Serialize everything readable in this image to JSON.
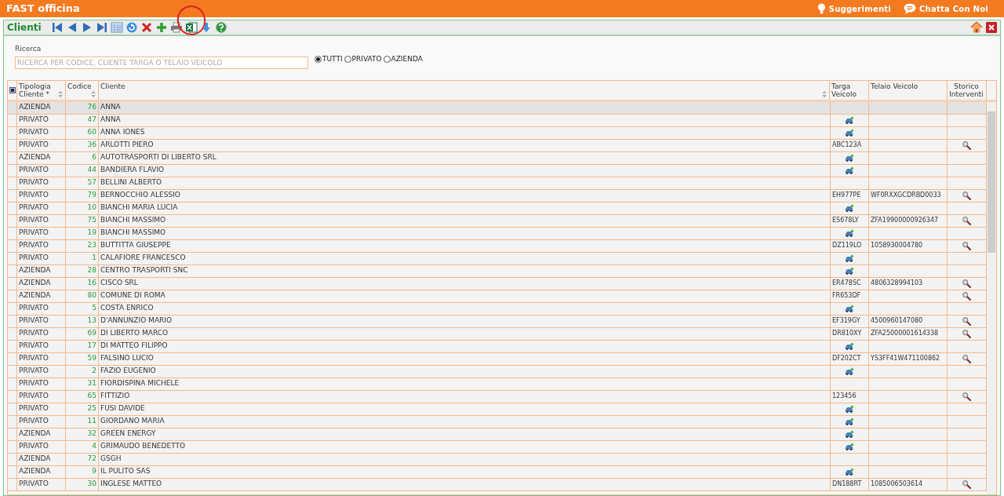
{
  "app": {
    "title": "FAST officina",
    "links": [
      {
        "kind": "bulb",
        "label": "Suggerimenti"
      },
      {
        "kind": "chat",
        "label": "Chatta Con Noi"
      }
    ]
  },
  "toolbar": {
    "title": "Clienti",
    "annotation_circle": true
  },
  "search": {
    "label": "Ricerca",
    "placeholder": "RICERCA PER CODICE, CLIENTE TARGA O TELAIO VEICOLO",
    "filters": [
      {
        "label": "TUTTI",
        "selected": true
      },
      {
        "label": "PRIVATO",
        "selected": false
      },
      {
        "label": "AZIENDA",
        "selected": false
      }
    ]
  },
  "table": {
    "select_all_checked": true,
    "columns": [
      {
        "label": "Tipologia Cliente *",
        "sortable": true
      },
      {
        "label": "Codice",
        "sortable": true
      },
      {
        "label": "Cliente",
        "sortable": true
      },
      {
        "label": "Targa Veicolo",
        "sortable": false
      },
      {
        "label": "Telaio Veicolo",
        "sortable": false
      },
      {
        "label": "Storico Interventi",
        "sortable": false
      }
    ],
    "rows": [
      {
        "tipologia": "AZIENDA",
        "codice": "76",
        "cliente": "ANNA",
        "add_vehicle": false,
        "history": false,
        "selected": true
      },
      {
        "tipologia": "PRIVATO",
        "codice": "47",
        "cliente": "ANNA",
        "add_vehicle": true,
        "history": false,
        "selected": false
      },
      {
        "tipologia": "PRIVATO",
        "codice": "60",
        "cliente": "ANNA IONES",
        "add_vehicle": true,
        "history": false,
        "selected": false
      },
      {
        "tipologia": "PRIVATO",
        "codice": "36",
        "cliente": "ARLOTTI PIERO",
        "targa": "ABC123A",
        "add_vehicle": false,
        "history": true,
        "selected": false
      },
      {
        "tipologia": "AZIENDA",
        "codice": "6",
        "cliente": "AUTOTRASPORTI DI LIBERTO SRL",
        "add_vehicle": true,
        "history": false,
        "selected": false
      },
      {
        "tipologia": "PRIVATO",
        "codice": "44",
        "cliente": "BANDIERA FLAVIO",
        "add_vehicle": true,
        "history": false,
        "selected": false
      },
      {
        "tipologia": "PRIVATO",
        "codice": "57",
        "cliente": "BELLINI ALBERTO",
        "add_vehicle": false,
        "history": false,
        "selected": false
      },
      {
        "tipologia": "PRIVATO",
        "codice": "79",
        "cliente": "BERNOCCHIO ALESSIO",
        "targa": "EH977PE",
        "telaio": "WF0RXXGCDRBD0033",
        "add_vehicle": false,
        "history": true,
        "selected": false
      },
      {
        "tipologia": "PRIVATO",
        "codice": "10",
        "cliente": "BIANCHI MARIA LUCIA",
        "add_vehicle": true,
        "history": false,
        "selected": false
      },
      {
        "tipologia": "PRIVATO",
        "codice": "75",
        "cliente": "BIANCHI MASSIMO",
        "targa": "ES678LY",
        "telaio": "ZFA19900000926347",
        "add_vehicle": false,
        "history": true,
        "selected": false
      },
      {
        "tipologia": "PRIVATO",
        "codice": "19",
        "cliente": "BIANCHI MASSIMO",
        "add_vehicle": true,
        "history": false,
        "selected": false
      },
      {
        "tipologia": "PRIVATO",
        "codice": "23",
        "cliente": "BUTTITTA GIUSEPPE",
        "targa": "DZ119LO",
        "telaio": "1058930004780",
        "add_vehicle": false,
        "history": true,
        "selected": false
      },
      {
        "tipologia": "PRIVATO",
        "codice": "1",
        "cliente": "CALAFIORE FRANCESCO",
        "add_vehicle": true,
        "history": false,
        "selected": false
      },
      {
        "tipologia": "AZIENDA",
        "codice": "28",
        "cliente": "CENTRO TRASPORTI SNC",
        "add_vehicle": true,
        "history": false,
        "selected": false
      },
      {
        "tipologia": "AZIENDA",
        "codice": "16",
        "cliente": "CISCO SRL",
        "targa": "ER478SC",
        "telaio": "4806328994103",
        "add_vehicle": false,
        "history": true,
        "selected": false
      },
      {
        "tipologia": "AZIENDA",
        "codice": "80",
        "cliente": "COMUNE DI ROMA",
        "targa": "FR653DF",
        "add_vehicle": false,
        "history": true,
        "selected": false
      },
      {
        "tipologia": "PRIVATO",
        "codice": "5",
        "cliente": "COSTA ENRICO",
        "add_vehicle": true,
        "history": false,
        "selected": false
      },
      {
        "tipologia": "PRIVATO",
        "codice": "13",
        "cliente": "D'ANNUNZIO MARIO",
        "targa": "EF319GY",
        "telaio": "4500960147080",
        "add_vehicle": false,
        "history": true,
        "selected": false
      },
      {
        "tipologia": "PRIVATO",
        "codice": "69",
        "cliente": "DI LIBERTO MARCO",
        "targa": "DR810XY",
        "telaio": "ZFA25000001614338",
        "add_vehicle": false,
        "history": true,
        "selected": false
      },
      {
        "tipologia": "PRIVATO",
        "codice": "17",
        "cliente": "DI MATTEO FILIPPO",
        "add_vehicle": true,
        "history": false,
        "selected": false
      },
      {
        "tipologia": "PRIVATO",
        "codice": "59",
        "cliente": "FALSINO LUCIO",
        "targa": "DF202CT",
        "telaio": "YS3FF41W471100862",
        "add_vehicle": false,
        "history": true,
        "selected": false
      },
      {
        "tipologia": "PRIVATO",
        "codice": "2",
        "cliente": "FAZIO EUGENIO",
        "add_vehicle": true,
        "history": false,
        "selected": false
      },
      {
        "tipologia": "PRIVATO",
        "codice": "31",
        "cliente": "FIORDISPINA MICHELE",
        "add_vehicle": false,
        "history": false,
        "selected": false
      },
      {
        "tipologia": "PRIVATO",
        "codice": "65",
        "cliente": "FITTIZIO",
        "targa": "123456",
        "add_vehicle": false,
        "history": true,
        "selected": false
      },
      {
        "tipologia": "PRIVATO",
        "codice": "25",
        "cliente": "FUSI DAVIDE",
        "add_vehicle": true,
        "history": false,
        "selected": false
      },
      {
        "tipologia": "PRIVATO",
        "codice": "11",
        "cliente": "GIORDANO MARIA",
        "add_vehicle": true,
        "history": false,
        "selected": false
      },
      {
        "tipologia": "AZIENDA",
        "codice": "32",
        "cliente": "GREEN ENERGY",
        "add_vehicle": true,
        "history": false,
        "selected": false
      },
      {
        "tipologia": "PRIVATO",
        "codice": "4",
        "cliente": "GRIMAUDO BENEDETTO",
        "add_vehicle": true,
        "history": false,
        "selected": false
      },
      {
        "tipologia": "AZIENDA",
        "codice": "72",
        "cliente": "GSGH",
        "add_vehicle": false,
        "history": false,
        "selected": false
      },
      {
        "tipologia": "AZIENDA",
        "codice": "9",
        "cliente": "IL PULITO SAS",
        "add_vehicle": true,
        "history": false,
        "selected": false
      },
      {
        "tipologia": "PRIVATO",
        "codice": "30",
        "cliente": "INGLESE MATTEO",
        "targa": "DN188RT",
        "telaio": "1085006503614",
        "add_vehicle": false,
        "history": true,
        "selected": false
      }
    ]
  }
}
